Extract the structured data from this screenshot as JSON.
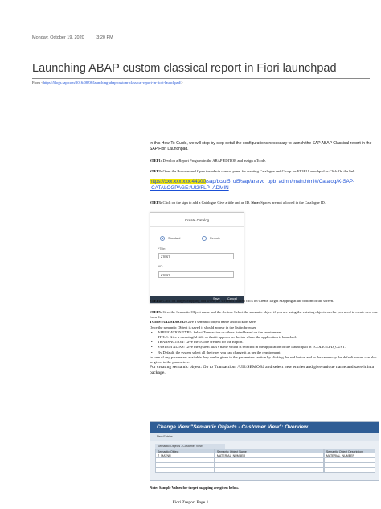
{
  "meta": {
    "date": "Monday, October 19, 2020",
    "time": "3:20 PM"
  },
  "title": "Launching ABAP custom classical report in Fiori launchpad",
  "source": {
    "prefix": "From <",
    "url": "https://blogs.sap.com/2016/08/08/launching-abap-custom-classical-report-in-fiori-launchpad/",
    "suffix": ">"
  },
  "intro": "In this How-To Guide, we will step-by-step detail the configurations necessary to launch the SAP ABAP Classical report in the SAP Fiori Launchpad.",
  "step1": {
    "label": "STEP1:",
    "text": " Develop a Report Program in the ABAP EDITOR and assign a Tcode."
  },
  "step2": {
    "label": "STEP2:",
    "text": " Open the Browser and Open the admin control panel for creating Catalogue and Group for FIORI Launchpad or Click On the link"
  },
  "url": {
    "host": "https://xxx.xxx.xxx:44300",
    "path": "/sap/bc/ui5_ui5/sap/arsrvc_upb_admn/main.html#/Catalog/X-SAP-",
    "line2": "-CATALOGPAGE:/UI2/FLP_ADMIN"
  },
  "step3": {
    "label": "STEP3:",
    "text": " Click on the sign to add a Catalogue Give a title and an ID. ",
    "note_label": "Note:",
    "note": " Spaces are not allowed in the Catalogue ID."
  },
  "dialog": {
    "title": "Create Catalog",
    "radio1": "Standard",
    "radio2": "Remote",
    "title_label": "*Title:",
    "title_value": "ZTEST",
    "id_label": "*ID:",
    "id_value": "ZTEST",
    "save": "Save",
    "cancel": "Cancel"
  },
  "step4": {
    "label": "STEP4:",
    "text": " Click on Target Mapping and when the screen is loaded click on Create Target Mapping at the bottom of the screen."
  },
  "step5": {
    "label": "STEP5:",
    "text": " Give the Semantic Object name and the Action. Select the semantic object if you are using the existing objects or else you need to create new one from the",
    "tcode_label": "TCode: /UI2/SEMOBJ",
    "tcode_text": " Give a semantic object name and click on save.",
    "once": "Once the semantic Object is saved it should appear in the list in browser",
    "bullets": [
      "APPLICATION TYPE: Select Transaction or others listed based on the requirement.",
      "TITLE: Give a meaningful title so that it appears on the tab where the application is launched.",
      "TRANSACTION: Give the TCode created for the Report.",
      "SYSTEM ALIAS: Give the system alias's name which is selected in the application of the Launchpad in   TCODE: LPD_CUST.",
      "By Default, the system select all the types you can change it as per the requirement."
    ],
    "params": "In case of any parameters available they can be given in the parameters section by clicking the add button and in the same way the default values can also be given to the parameters.",
    "create": "For creating semantic object: Go to Transaction: /UI2/SEMOBJ and select new entries and give unique name and save it in a package."
  },
  "sap": {
    "title": "Change View \"Semantic Objects - Customer View\": Overview",
    "toolbar": [
      "New Entries",
      "",
      "",
      "",
      ""
    ],
    "caption": "Semantic Objects - Customer View",
    "headers": [
      "Semantic Object",
      "Semantic Object Name",
      "Semantic Object Description"
    ],
    "row": [
      "Z_MATNR",
      "MATERIAL_NUMBER",
      "MATERIAL_NUMBER"
    ]
  },
  "note": "Note: Sample Values for target mapping are given below.",
  "footer": "Fiori Zreport Page 1"
}
